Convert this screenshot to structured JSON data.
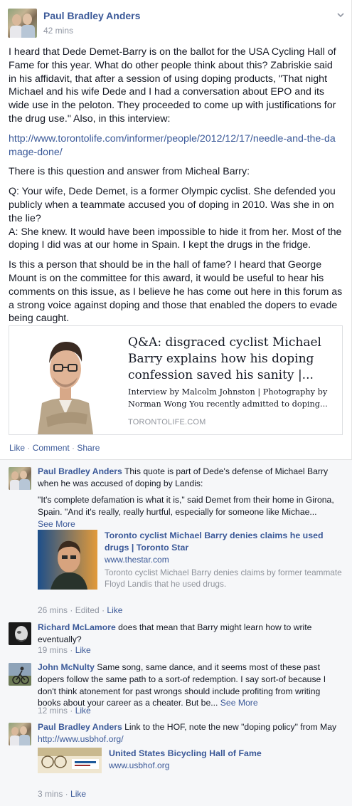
{
  "post": {
    "author": "Paul Bradley Anders",
    "time": "42 mins",
    "paragraphs": [
      "I heard that Dede Demet-Barry is on the ballot for the USA Cycling Hall of Fame for this year. What do other people think about this? Zabriskie said in his affidavit, that after a session of using doping products, \"That night Michael and his wife Dede and I had a conversation about EPO and its wide use in the peloton. They proceeded to come up with justifications for the drug use.\" Also, in this interview:",
      "There is this question and answer from Micheal Barry:",
      "Is this a person that should be in the hall of fame? I heard that George Mount is on the committee for this award, it would be useful to hear his comments on this issue, as I believe he has come out here in this forum as a strong voice against doping and those that enabled the dopers to evade being caught."
    ],
    "link_url": "http://www.torontolife.com/informer/people/2012/12/17/needle-and-the-damage-done/",
    "qa_question": "Q: Your wife, Dede Demet, is a former Olympic cyclist. She defended you publicly when a teammate accused you of doping in 2010. Was she in on the lie?",
    "qa_answer": "A: She knew. It would have been impossible to hide it from her. Most of the doping I did was at our home in Spain. I kept the drugs in the fridge.",
    "share": {
      "title": "Q&A: disgraced cyclist Michael Barry explains how his doping confession saved his sanity |...",
      "description": "Interview by Malcolm Johnston | Photography by Norman Wong You recently admitted to doping...",
      "domain": "TORONTOLIFE.COM"
    },
    "actions": {
      "like": "Like",
      "comment": "Comment",
      "share": "Share",
      "sep": " · "
    }
  },
  "comments": [
    {
      "author": "Paul Bradley Anders",
      "text": "This quote is part of Dede's defense of Michael Barry when he was accused of doping by Landis:",
      "quote": "\"It's complete defamation is what it is,\" said Demet from their home in Girona, Spain. \"And it's really, really hurtful, especially for someone like Michae...",
      "see_more": "See More",
      "preview": {
        "title": "Toronto cyclist Michael Barry denies claims he used drugs | Toronto Star",
        "url": "www.thestar.com",
        "description": "Toronto cyclist Michael Barry denies claims by former teammate Floyd Landis that he used drugs."
      },
      "time": "26 mins",
      "edited": "Edited",
      "like": "Like"
    },
    {
      "author": "Richard McLamore",
      "text": "does that mean that Barry might learn how to write eventually?",
      "time": "19 mins",
      "like": "Like"
    },
    {
      "author": "John McNulty",
      "text": "Same song, same dance, and it seems most of these past dopers follow the same path to a sort-of redemption. I say sort-of because I don't think atonement for past wrongs should include profiting from writing books about your career as a cheater. But be...",
      "see_more": "See More",
      "time": "12 mins",
      "like": "Like"
    },
    {
      "author": "Paul Bradley Anders",
      "text": "Link to the HOF, note the new \"doping policy\" from May",
      "url": "http://www.usbhof.org/",
      "preview": {
        "title": "United States Bicycling Hall of Fame",
        "url": "www.usbhof.org"
      },
      "time": "3 mins",
      "like": "Like"
    }
  ],
  "colors": {
    "link": "#3b5998",
    "meta": "#9197a3",
    "comments_bg": "#f6f7f9"
  }
}
